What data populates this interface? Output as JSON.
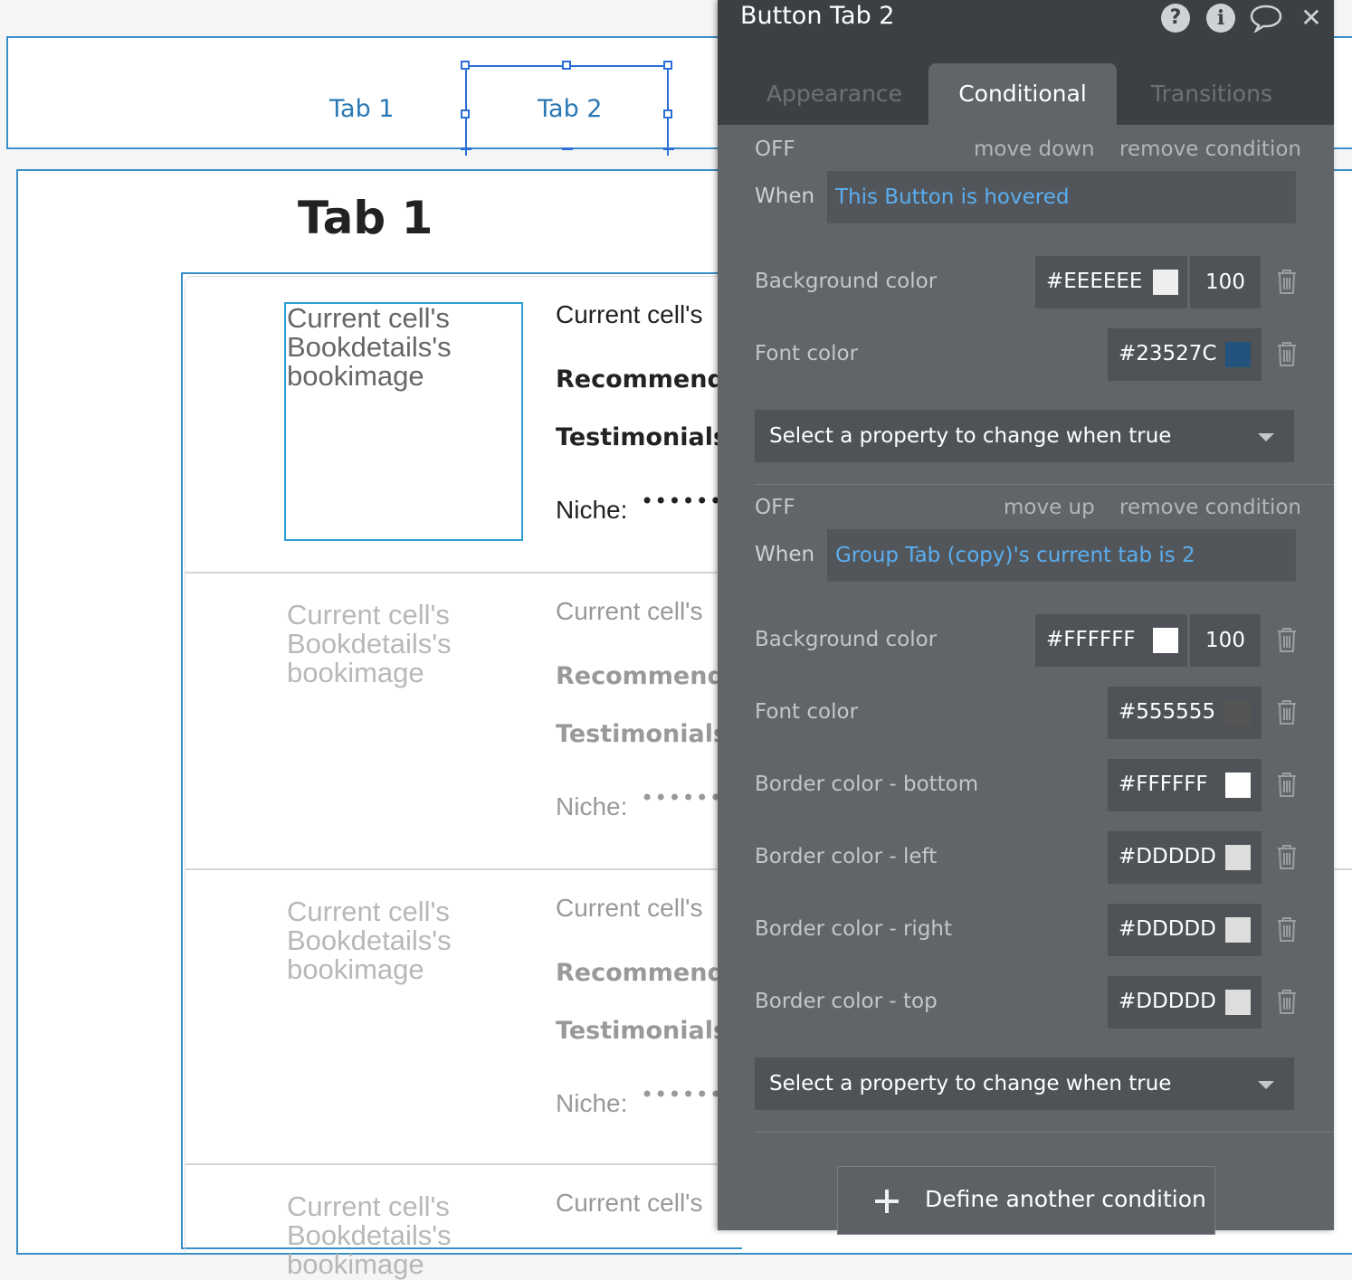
{
  "canvas": {
    "tabs": [
      "Tab 1",
      "Tab 2"
    ],
    "heading": "Tab 1",
    "cell": {
      "image_text": [
        "Current cell's",
        "Bookdetails's",
        "bookimage"
      ],
      "line1": "Current cell's",
      "line2": "Recommende",
      "line3": "Testimonials (",
      "niche_label": "Niche:",
      "niche_dots": "••••••••"
    }
  },
  "panel": {
    "title": "Button Tab 2",
    "header_icons": [
      "help-icon",
      "info-icon",
      "comment-icon",
      "close-icon"
    ],
    "tabs": [
      {
        "label": "Appearance",
        "active": false
      },
      {
        "label": "Conditional",
        "active": true
      },
      {
        "label": "Transitions",
        "active": false
      }
    ],
    "conditions": [
      {
        "status": "OFF",
        "move_label": "move down",
        "remove_label": "remove condition",
        "when_label": "When",
        "expression": "This Button is hovered",
        "properties": [
          {
            "label": "Background color",
            "hex": "#EEEEEE",
            "swatch": "#EEEEEE",
            "opacity": "100"
          },
          {
            "label": "Font color",
            "hex": "#23527C",
            "swatch": "#23527C"
          }
        ],
        "select_placeholder": "Select a property to change when true"
      },
      {
        "status": "OFF",
        "move_label": "move up",
        "remove_label": "remove condition",
        "when_label": "When",
        "expression": "Group Tab (copy)'s current tab is 2",
        "properties": [
          {
            "label": "Background color",
            "hex": "#FFFFFF",
            "swatch": "#FFFFFF",
            "opacity": "100"
          },
          {
            "label": "Font color",
            "hex": "#555555",
            "swatch": "#555555"
          },
          {
            "label": "Border color - bottom",
            "hex": "#FFFFFF",
            "swatch": "#FFFFFF"
          },
          {
            "label": "Border color - left",
            "hex": "#DDDDD",
            "swatch": "#DDDDDD"
          },
          {
            "label": "Border color - right",
            "hex": "#DDDDD",
            "swatch": "#DDDDDD"
          },
          {
            "label": "Border color - top",
            "hex": "#DDDDD",
            "swatch": "#DDDDDD"
          }
        ],
        "select_placeholder": "Select a property to change when true"
      }
    ],
    "define_button": "Define another condition"
  },
  "colors": {
    "panel_bg": "#616569",
    "header_bg": "#3c4043",
    "expression_blue": "#5aaef0",
    "selection_blue": "#2b6fd6"
  }
}
